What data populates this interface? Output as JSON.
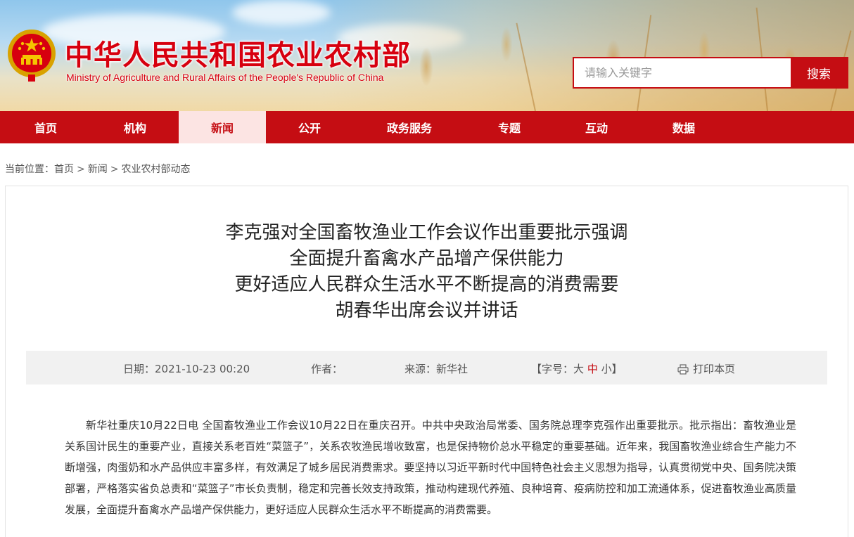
{
  "header": {
    "title_cn": "中华人民共和国农业农村部",
    "title_en": "Ministry of Agriculture and Rural Affairs of the People's Republic of China",
    "emblem_icon": "national-emblem-icon"
  },
  "search": {
    "placeholder": "请输入关键字",
    "button_label": "搜索"
  },
  "nav": {
    "items": [
      {
        "label": "首页"
      },
      {
        "label": "机构"
      },
      {
        "label": "新闻"
      },
      {
        "label": "公开"
      },
      {
        "label": "政务服务"
      },
      {
        "label": "专题"
      },
      {
        "label": "互动"
      },
      {
        "label": "数据"
      }
    ],
    "active": "新闻"
  },
  "breadcrumb": {
    "prefix": "当前位置：",
    "items": [
      "首页",
      "新闻",
      "农业农村部动态"
    ],
    "separator": ">"
  },
  "article": {
    "headline": [
      "李克强对全国畜牧渔业工作会议作出重要批示强调",
      "全面提升畜禽水产品增产保供能力",
      "更好适应人民群众生活水平不断提高的消费需要",
      "胡春华出席会议并讲话"
    ],
    "meta": {
      "date_label": "日期：",
      "date": "2021-10-23 00:20",
      "author_label": "作者：",
      "author": "",
      "source_label": "来源：",
      "source": "新华社",
      "font_size_open": "【字号：",
      "font_size_large": "大",
      "font_size_medium": "中",
      "font_size_small": "小",
      "font_size_close": "】",
      "print_label": "打印本页"
    },
    "body": "新华社重庆10月22日电 全国畜牧渔业工作会议10月22日在重庆召开。中共中央政治局常委、国务院总理李克强作出重要批示。批示指出：畜牧渔业是关系国计民生的重要产业，直接关系老百姓“菜篮子”，关系农牧渔民增收致富，也是保持物价总水平稳定的重要基础。近年来，我国畜牧渔业综合生产能力不断增强，肉蛋奶和水产品供应丰富多样，有效满足了城乡居民消费需求。要坚持以习近平新时代中国特色社会主义思想为指导，认真贯彻党中央、国务院决策部署，严格落实省负总责和“菜篮子”市长负责制，稳定和完善长效支持政策，推动构建现代养殖、良种培育、疫病防控和加工流通体系，促进畜牧渔业高质量发展，全面提升畜禽水产品增产保供能力，更好适应人民群众生活水平不断提高的消费需要。"
  },
  "colors": {
    "brand_red": "#c50d13",
    "nav_active_bg": "#fce4e3",
    "title_red": "#d7000f"
  }
}
